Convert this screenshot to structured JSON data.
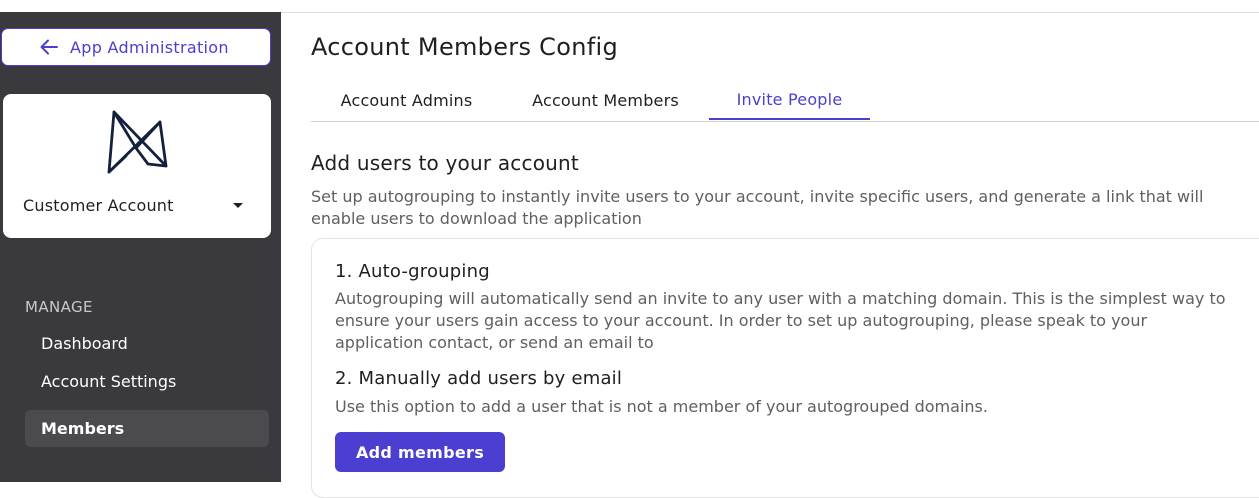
{
  "sidebar": {
    "back_label": "App Administration",
    "account_name": "Customer Account",
    "section_label": "MANAGE",
    "nav_items": [
      {
        "label": "Dashboard",
        "active": false
      },
      {
        "label": "Account Settings",
        "active": false
      },
      {
        "label": "Members",
        "active": true
      }
    ]
  },
  "main": {
    "title": "Account Members Config",
    "tabs": [
      {
        "label": "Account Admins",
        "active": false
      },
      {
        "label": "Account Members",
        "active": false
      },
      {
        "label": "Invite People",
        "active": true
      }
    ],
    "section_title": "Add users to your account",
    "section_description": "Set up autogrouping to instantly invite users to your account, invite specific users, and generate a link that will enable users to download the application",
    "steps": [
      {
        "title": "1. Auto-grouping",
        "description": "Autogrouping will automatically send an invite to any user with a matching domain.  This is the simplest way to ensure your users gain access to your account. In order to set up autogrouping, please speak to your application contact, or send an email to"
      },
      {
        "title": "2. Manually add users by email",
        "description": "Use this option to add a user that is not a member of your autogrouped domains."
      }
    ],
    "add_button_label": "Add members"
  },
  "colors": {
    "accent": "#4a3fd0",
    "sidebar_bg": "#3a393e",
    "logo": "#14213d"
  },
  "icons": {
    "back": "arrow-left-icon",
    "logo": "brand-logo",
    "account_dropdown": "caret-down-icon"
  }
}
